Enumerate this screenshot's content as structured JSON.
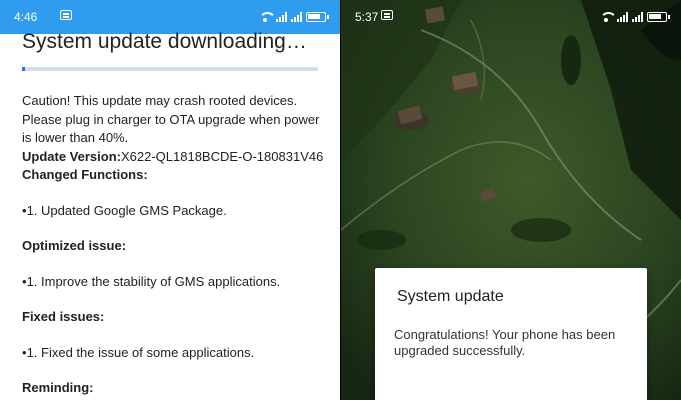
{
  "left_screen": {
    "status_time": "4:46",
    "title": "System update downloading…",
    "download_progress": 0.01,
    "caution": "Caution! This update may crash rooted devices. Please plug in charger to OTA upgrade when power is lower than 40%.",
    "update_version_label": "Update Version:",
    "update_version_value": "X622-QL1818BCDE-O-180831V46",
    "changed_functions_heading": "Changed Functions:",
    "changed_functions_item": "1. Updated Google GMS Package.",
    "optimized_heading": "Optimized issue:",
    "optimized_item": "1. Improve the stability of GMS applications.",
    "fixed_heading": "Fixed issues:",
    "fixed_item": "1. Fixed the issue of some applications.",
    "reminding_heading": "Reminding:"
  },
  "right_screen": {
    "status_time": "5:37",
    "dialog_title": "System update",
    "dialog_message": "Congratulations! Your phone has been upgraded successfully."
  },
  "colors": {
    "status_bar_blue": "#2f9cf0",
    "progress_fill": "#2b7bd6",
    "progress_track": "#cfe0f2"
  },
  "icons": [
    "message-icon",
    "wifi-icon",
    "signal-icon",
    "battery-icon"
  ]
}
